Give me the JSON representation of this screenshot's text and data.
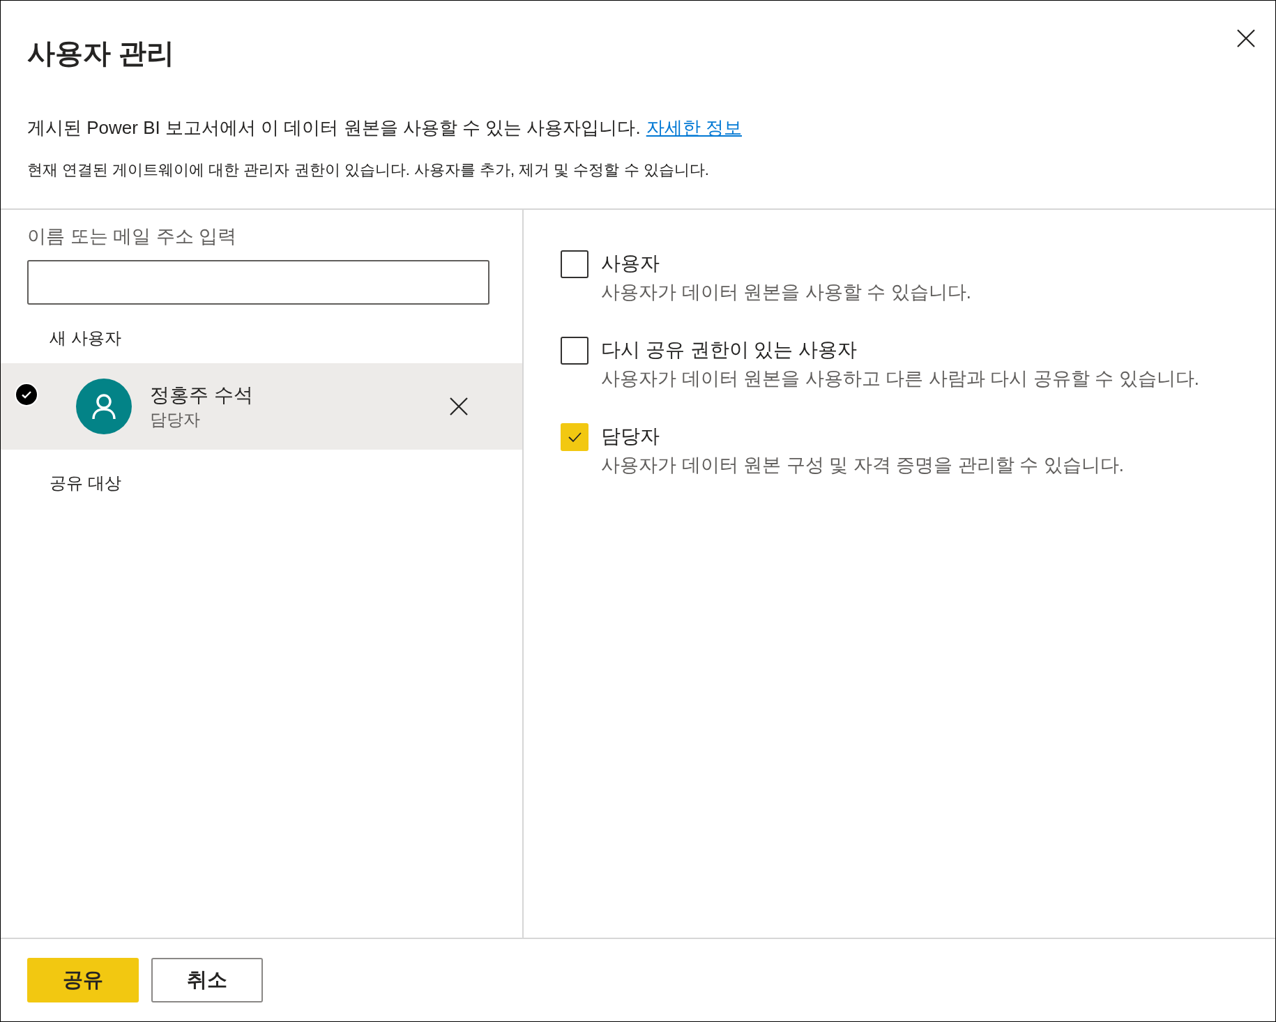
{
  "dialog": {
    "title": "사용자 관리",
    "description": "게시된 Power BI 보고서에서 이 데이터 원본을 사용할 수 있는 사용자입니다.",
    "link": "자세한 정보",
    "note": "현재 연결된 게이트웨이에 대한 관리자 권한이 있습니다. 사용자를 추가, 제거 및 수정할 수 있습니다."
  },
  "search": {
    "label": "이름 또는 메일 주소 입력"
  },
  "new_users": {
    "heading": "새 사용자",
    "users": [
      {
        "name": "정홍주 수석",
        "role": "담당자",
        "selected": true
      }
    ]
  },
  "shared_with": {
    "heading": "공유 대상"
  },
  "permissions": [
    {
      "label": "사용자",
      "description": "사용자가 데이터 원본을 사용할 수 있습니다.",
      "checked": false
    },
    {
      "label": "다시 공유 권한이 있는 사용자",
      "description": "사용자가 데이터 원본을 사용하고 다른 사람과 다시 공유할 수 있습니다.",
      "checked": false
    },
    {
      "label": "담당자",
      "description": "사용자가 데이터 원본 구성 및 자격 증명을 관리할 수 있습니다.",
      "checked": true
    }
  ],
  "buttons": [
    {
      "label": "공유",
      "kind": "primary"
    },
    {
      "label": "취소",
      "kind": "secondary"
    }
  ]
}
